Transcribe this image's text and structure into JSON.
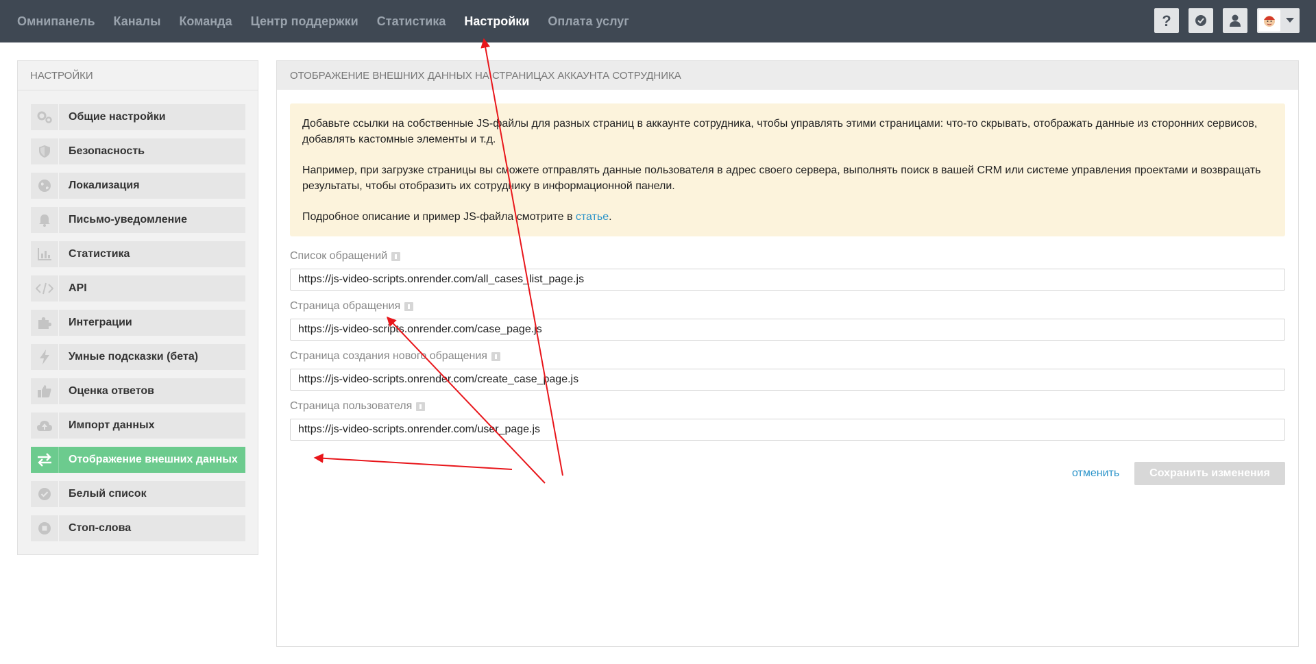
{
  "nav": {
    "items": [
      {
        "label": "Омнипанель",
        "active": false
      },
      {
        "label": "Каналы",
        "active": false
      },
      {
        "label": "Команда",
        "active": false
      },
      {
        "label": "Центр поддержки",
        "active": false
      },
      {
        "label": "Статистика",
        "active": false
      },
      {
        "label": "Настройки",
        "active": true
      },
      {
        "label": "Оплата услуг",
        "active": false
      }
    ],
    "icons": [
      "help-icon",
      "check-shield-icon",
      "user-icon",
      "avatar",
      "caret-down-icon"
    ]
  },
  "sidebar": {
    "title": "НАСТРОЙКИ",
    "items": [
      {
        "label": "Общие настройки",
        "icon": "gears-icon"
      },
      {
        "label": "Безопасность",
        "icon": "shield-icon"
      },
      {
        "label": "Локализация",
        "icon": "globe-icon"
      },
      {
        "label": "Письмо-уведомление",
        "icon": "bell-icon"
      },
      {
        "label": "Статистика",
        "icon": "bar-chart-icon"
      },
      {
        "label": "API",
        "icon": "code-icon"
      },
      {
        "label": "Интеграции",
        "icon": "puzzle-icon"
      },
      {
        "label": "Умные подсказки (бета)",
        "icon": "lightning-icon"
      },
      {
        "label": "Оценка ответов",
        "icon": "thumbs-up-icon"
      },
      {
        "label": "Импорт данных",
        "icon": "cloud-upload-icon"
      },
      {
        "label": "Отображение внешних данных",
        "icon": "swap-arrows-icon",
        "active": true
      },
      {
        "label": "Белый список",
        "icon": "check-badge-icon"
      },
      {
        "label": "Стоп-слова",
        "icon": "stop-circle-icon"
      }
    ]
  },
  "main": {
    "title": "ОТОБРАЖЕНИЕ ВНЕШНИХ ДАННЫХ НА СТРАНИЦАХ АККАУНТА СОТРУДНИКА",
    "info": {
      "p1": "Добавьте ссылки на собственные JS-файлы для разных страниц в аккаунте сотрудника, чтобы управлять этими страницами: что-то скрывать, отображать данные из сторонних сервисов, добавлять кастомные элементы и т.д.",
      "p2": "Например, при загрузке страницы вы сможете отправлять данные пользователя в адрес своего сервера, выполнять поиск в вашей CRM или системе управления проектами и возвращать результаты, чтобы отобразить их сотруднику в информационной панели.",
      "p3_prefix": "Подробное описание и пример JS-файла смотрите в ",
      "p3_link": "статье",
      "p3_suffix": "."
    },
    "fields": [
      {
        "label": "Список обращений",
        "value": "https://js-video-scripts.onrender.com/all_cases_list_page.js"
      },
      {
        "label": "Страница обращения",
        "value": "https://js-video-scripts.onrender.com/case_page.js"
      },
      {
        "label": "Страница создания нового обращения",
        "value": "https://js-video-scripts.onrender.com/create_case_page.js"
      },
      {
        "label": "Страница пользователя",
        "value": "https://js-video-scripts.onrender.com/user_page.js"
      }
    ],
    "cancel_label": "отменить",
    "save_label": "Сохранить изменения"
  },
  "colors": {
    "topbar": "#3f4853",
    "active_sidebar": "#6ccb8e",
    "link": "#2a93c9",
    "info_bg": "#fcf3dc",
    "annotation_arrows": "#e8161b"
  }
}
